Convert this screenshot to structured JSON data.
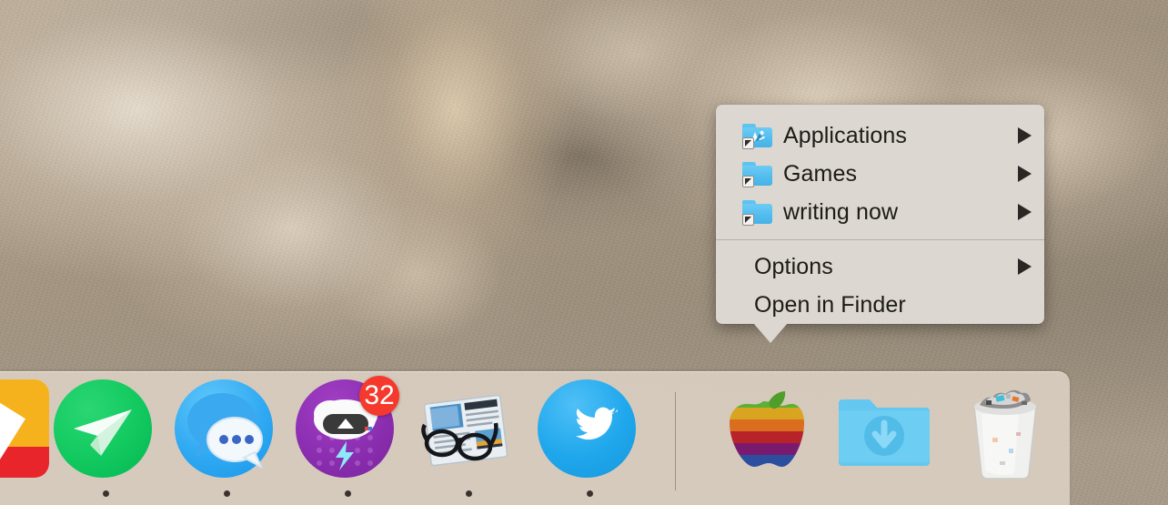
{
  "desktop": {
    "wallpaper_name": "salt-flat-rock-formation-wallpaper",
    "wallpaper_colors": [
      "#b7a894",
      "#a3947f",
      "#8a7d6c"
    ]
  },
  "context_menu": {
    "name": "dock-folder-context-menu",
    "background_color": "#dcd7d0",
    "text_color": "#1d1b18",
    "groups": [
      {
        "items": [
          {
            "label": "Applications",
            "icon": "applications-folder-alias-icon",
            "has_submenu": true
          },
          {
            "label": "Games",
            "icon": "games-folder-alias-icon",
            "has_submenu": true
          },
          {
            "label": "writing now",
            "icon": "writing-now-folder-alias-icon",
            "has_submenu": true
          }
        ]
      },
      {
        "items": [
          {
            "label": "Options",
            "icon": null,
            "has_submenu": true
          },
          {
            "label": "Open in Finder",
            "icon": null,
            "has_submenu": false
          }
        ]
      }
    ]
  },
  "dock": {
    "name": "macos-dock",
    "background_color": "#d9cec1",
    "items": [
      {
        "name": "photos",
        "label": "Photos",
        "icon": "photos-icon",
        "running": false,
        "badge": null
      },
      {
        "name": "telegram",
        "label": "Telegram",
        "icon": "paper-plane-icon",
        "running": true,
        "badge": null
      },
      {
        "name": "messages",
        "label": "Messages",
        "icon": "messages-icon",
        "running": true,
        "badge": null
      },
      {
        "name": "macupdater",
        "label": "MacUpdater",
        "icon": "macupdater-icon",
        "running": true,
        "badge": "32"
      },
      {
        "name": "readkit",
        "label": "ReadKit",
        "icon": "readkit-icon",
        "running": true,
        "badge": null
      },
      {
        "name": "twitter",
        "label": "Twitter",
        "icon": "twitter-icon",
        "running": true,
        "badge": null
      },
      {
        "name": "apple-folder",
        "label": "Apple",
        "icon": "rainbow-apple-icon",
        "running": false,
        "badge": null
      },
      {
        "name": "downloads",
        "label": "Downloads",
        "icon": "downloads-folder-icon",
        "running": false,
        "badge": null
      },
      {
        "name": "trash",
        "label": "Trash",
        "icon": "trash-full-icon",
        "running": false,
        "badge": null
      }
    ],
    "badge_color": "#f5392c",
    "separator": true
  }
}
